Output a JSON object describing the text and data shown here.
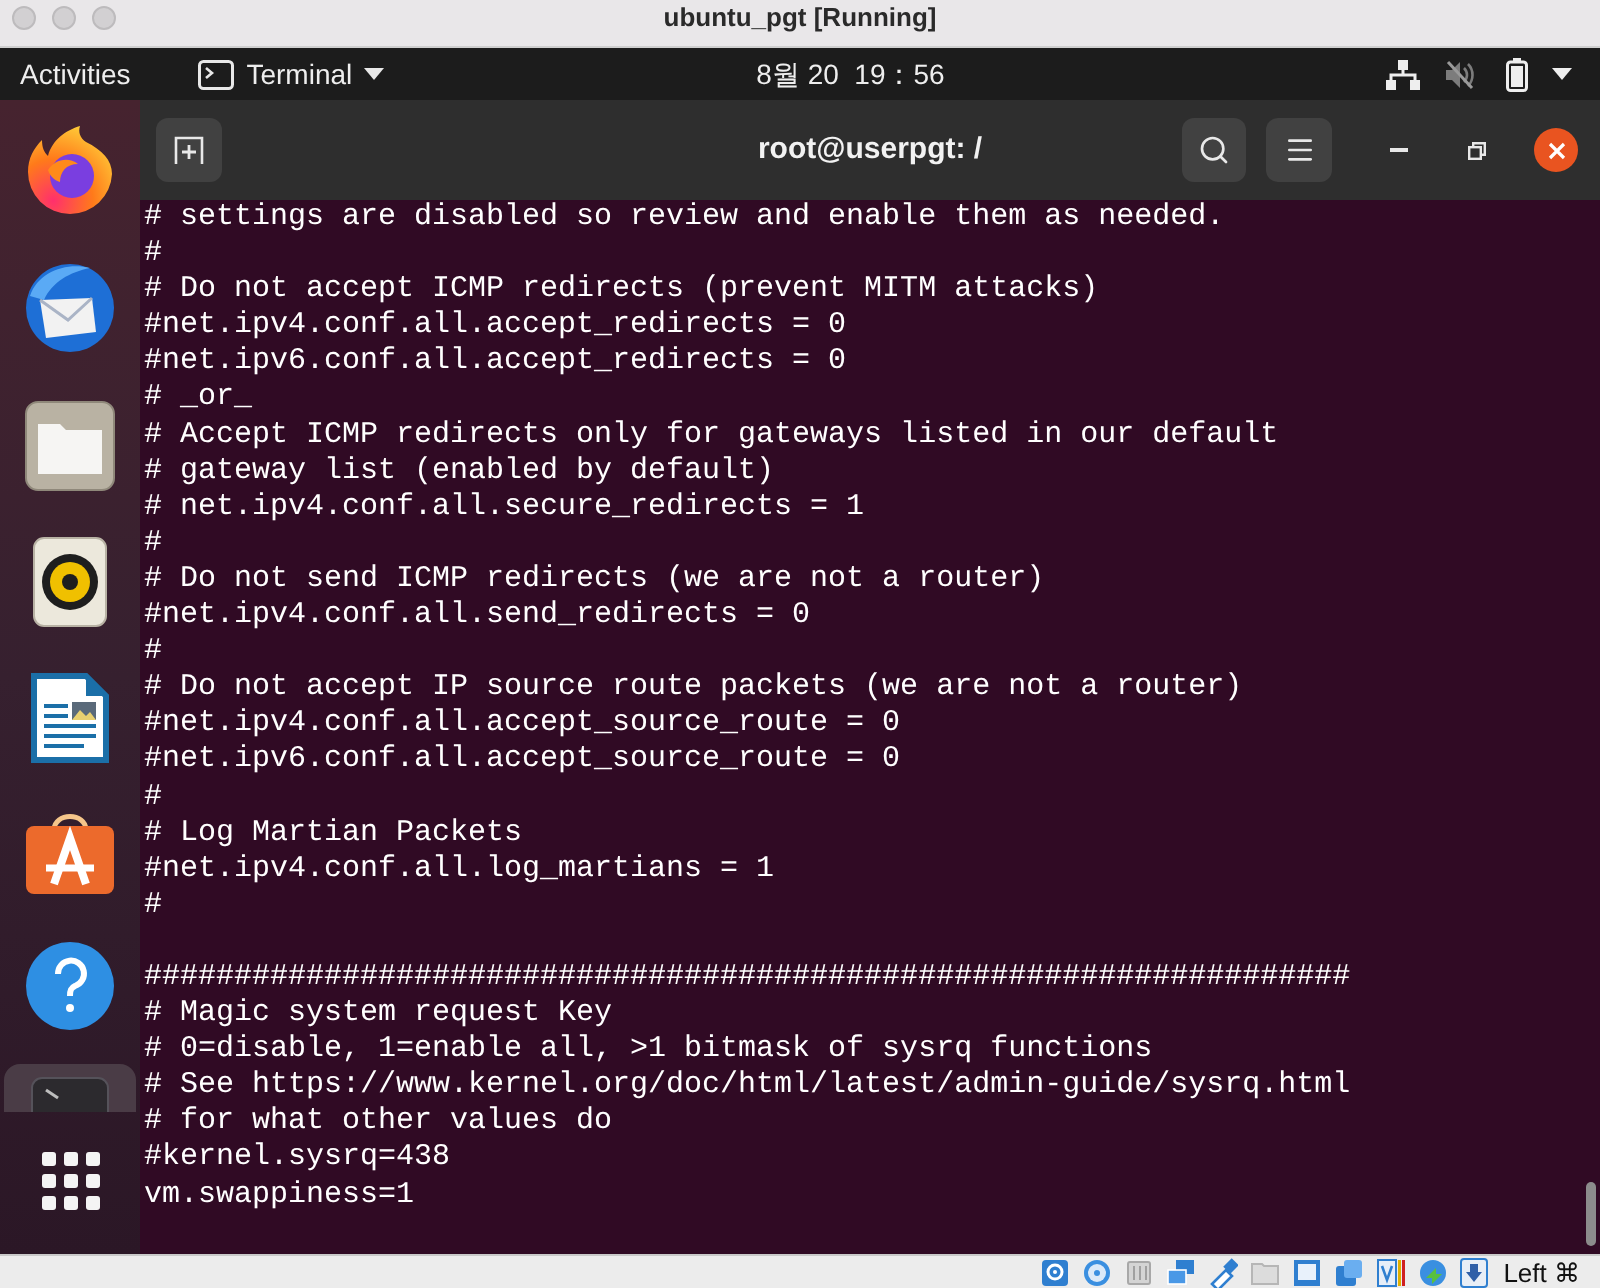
{
  "host_window": {
    "title": "ubuntu_pgt [Running]"
  },
  "top_bar": {
    "activities": "Activities",
    "app_menu": "Terminal",
    "clock": "8월 20  19：56",
    "muted": true
  },
  "dock": {
    "items": [
      {
        "kind": "browser",
        "selected": false
      },
      {
        "kind": "mail",
        "selected": false
      },
      {
        "kind": "files",
        "selected": false
      },
      {
        "kind": "music",
        "selected": false
      },
      {
        "kind": "writer",
        "selected": false
      },
      {
        "kind": "store",
        "selected": false
      },
      {
        "kind": "help",
        "selected": false
      },
      {
        "kind": "terminal",
        "selected": true
      },
      {
        "kind": "apps",
        "selected": false
      }
    ]
  },
  "terminal": {
    "title": "root@userpgt: /",
    "blocks": [
      {
        "lines": [
          "# settings are disabled so review and enable them as needed.",
          "#",
          "# Do not accept ICMP redirects (prevent MITM attacks)",
          "#net.ipv4.conf.all.accept_redirects = 0",
          "#net.ipv6.conf.all.accept_redirects = 0",
          "# _or_",
          "# Accept ICMP redirects only for gateways listed in our default",
          "# gateway list (enabled by default)",
          "# net.ipv4.conf.all.secure_redirects = 1",
          "#",
          "# Do not send ICMP redirects (we are not a router)",
          "#net.ipv4.conf.all.send_redirects = 0",
          "#",
          "# Do not accept IP source route packets (we are not a router)",
          "#net.ipv4.conf.all.accept_source_route = 0",
          "#net.ipv6.conf.all.accept_source_route = 0",
          "#",
          "# Log Martian Packets",
          "#net.ipv4.conf.all.log_martians = 1",
          "#"
        ]
      },
      {
        "lines": [
          "###################################################################",
          "# Magic system request Key",
          "# 0=disable, 1=enable all, >1 bitmask of sysrq functions",
          "# See https://www.kernel.org/doc/html/latest/admin-guide/sysrq.html",
          "# for what other values do",
          "#kernel.sysrq=438",
          "vm.swappiness=1"
        ]
      }
    ]
  },
  "status_bar": {
    "host_key": "Left ⌘"
  }
}
